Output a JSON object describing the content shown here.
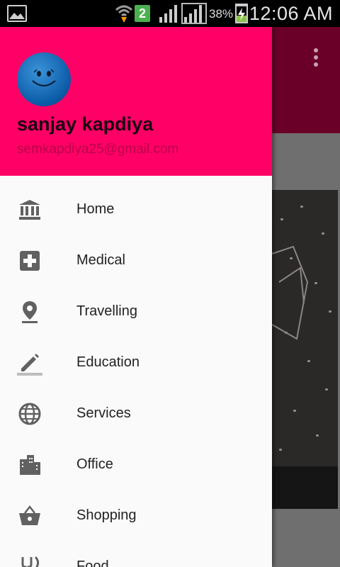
{
  "status_bar": {
    "notification_badge": "2",
    "battery_percent": "38%",
    "time": "12:06 AM"
  },
  "drawer": {
    "header_color": "#ff0066",
    "user": {
      "name": "sanjay kapdiya",
      "email": "semkapdiya25@gmail.com"
    },
    "items": [
      {
        "label": "Home",
        "icon": "bank-icon"
      },
      {
        "label": "Medical",
        "icon": "medical-plus-icon"
      },
      {
        "label": "Travelling",
        "icon": "location-pin-icon"
      },
      {
        "label": "Education",
        "icon": "pencil-icon"
      },
      {
        "label": "Services",
        "icon": "globe-icon"
      },
      {
        "label": "Office",
        "icon": "building-icon"
      },
      {
        "label": "Shopping",
        "icon": "shopping-basket-icon"
      },
      {
        "label": "Food",
        "icon": "food-icon"
      }
    ]
  }
}
